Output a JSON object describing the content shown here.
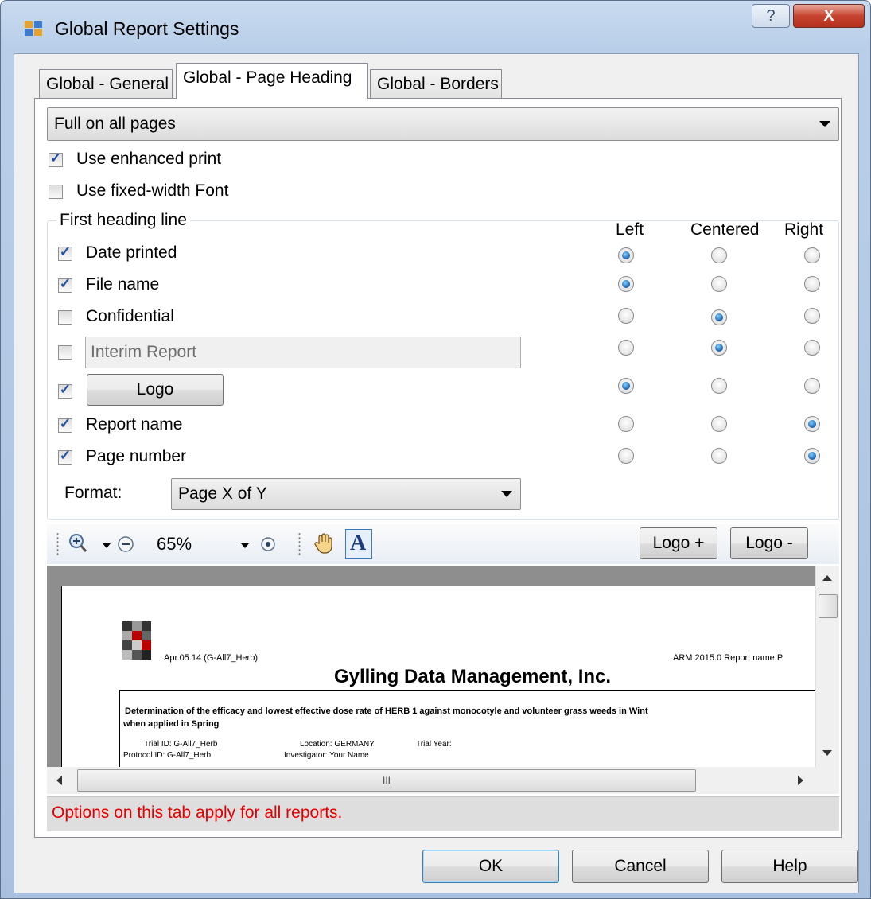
{
  "window": {
    "title": "Global Report Settings",
    "help_glyph": "?",
    "close_glyph": "X"
  },
  "tabs": [
    {
      "label": "Global - General",
      "active": false
    },
    {
      "label": "Global - Page Heading",
      "active": true
    },
    {
      "label": "Global - Borders",
      "active": false
    }
  ],
  "heading_mode": {
    "selected": "Full on all pages"
  },
  "options": {
    "enhanced_print": {
      "label": "Use enhanced print",
      "checked": true
    },
    "fixed_width_font": {
      "label": "Use fixed-width Font",
      "checked": false
    }
  },
  "first_heading_line": {
    "title": "First heading line",
    "columns": [
      "Left",
      "Centered",
      "Right"
    ],
    "rows": [
      {
        "label": "Date printed",
        "checked": true,
        "align": "Left"
      },
      {
        "label": "File name",
        "checked": true,
        "align": "Left"
      },
      {
        "label": "Confidential",
        "checked": false,
        "align": "Centered"
      },
      {
        "value": "Interim Report",
        "checked": false,
        "align": "Centered"
      },
      {
        "button": "Logo",
        "checked": true,
        "align": "Left"
      },
      {
        "label": "Report name",
        "checked": true,
        "align": "Right"
      },
      {
        "label": "Page number",
        "checked": true,
        "align": "Right"
      }
    ],
    "format_label": "Format:",
    "format_value": "Page X of Y"
  },
  "toolbar": {
    "zoom": "65%",
    "logo_plus": "Logo  +",
    "logo_minus": "Logo -",
    "icons": [
      "zoom-in-icon",
      "zoom-out-icon",
      "zoom-reset-icon",
      "hand-pan-icon",
      "text-select-icon"
    ]
  },
  "preview": {
    "left_header": "Apr.05.14 (G-All7_Herb)",
    "right_header": "ARM 2015.0 Report name P",
    "company": "Gylling Data Management, Inc.",
    "description_1": "Determination of the efficacy and lowest effective dose rate of HERB 1 against monocotyle and volunteer grass weeds in Wint",
    "description_2": "when applied in Spring",
    "trial_id": "Trial ID: G-All7_Herb",
    "location": "Location: GERMANY",
    "trial_year": "Trial Year:",
    "protocol_id": "Protocol ID: G-All7_Herb",
    "investigator": "Investigator: Your Name",
    "hscroll_thumb": "III"
  },
  "status_text": "Options on this tab apply for all reports.",
  "buttons": {
    "ok": "OK",
    "cancel": "Cancel",
    "help": "Help"
  },
  "colors": {
    "status_text": "#e00000",
    "radio_selected": "#1a5ea8",
    "check_mark": "#1f4fa5"
  }
}
